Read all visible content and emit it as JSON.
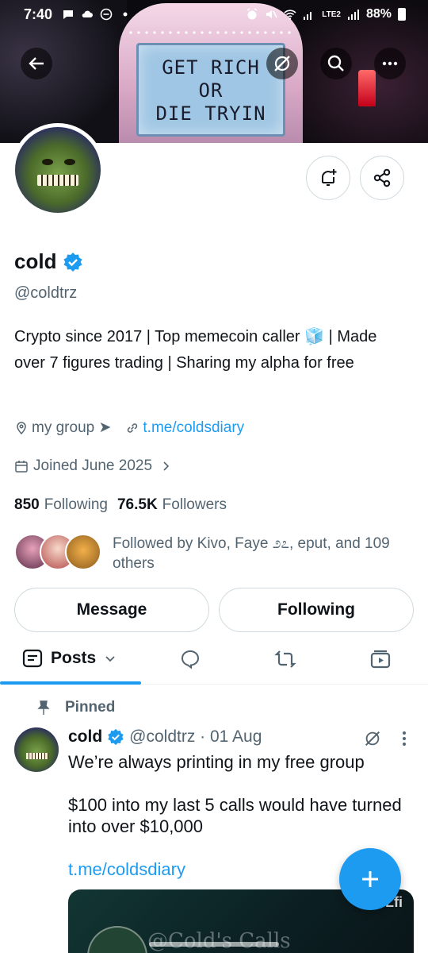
{
  "status_bar": {
    "time": "7:40",
    "battery": "88%",
    "network": "LTE2"
  },
  "banner": {
    "sign_lines": [
      "GET RICH",
      "OR",
      "DIE TRYIN"
    ]
  },
  "profile": {
    "name": "cold",
    "handle": "@coldtrz",
    "verified": true,
    "bio": "Crypto since 2017 | Top memecoin caller 🧊 | Made over 7 figures trading | Sharing my alpha for free",
    "location": "my group ➤",
    "link": "t.me/coldsdiary",
    "joined": "Joined June 2025",
    "following_count": "850",
    "following_label": "Following",
    "followers_count": "76.5K",
    "followers_label": "Followers",
    "followed_by": "Followed by Kivo, Faye ೨೭, eput, and 109 others"
  },
  "actions": {
    "message": "Message",
    "following": "Following"
  },
  "tabs": {
    "posts": "Posts"
  },
  "post": {
    "pinned_label": "Pinned",
    "name": "cold",
    "handle_date": "@coldtrz · 01 Aug",
    "line1": "We’re always printing in my free group",
    "line2": "$100 into my last 5 calls would have turned into over $10,000",
    "link": "t.me/coldsdiary",
    "card_text": "@Cold's Calls",
    "card_tag": "Lfi"
  },
  "colors": {
    "accent": "#1d9bf0",
    "text": "#0f1419",
    "muted": "#536471",
    "border": "#cfd9de"
  }
}
